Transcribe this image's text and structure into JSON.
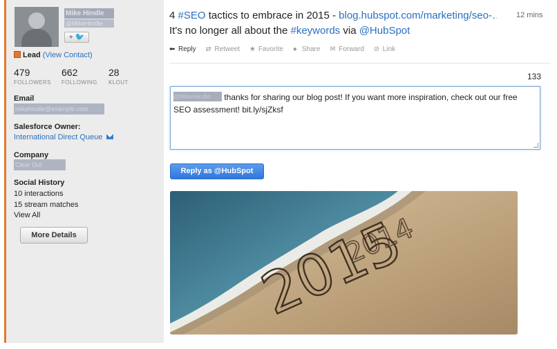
{
  "contact": {
    "name": "Mike Hindle",
    "handle": "@MikeHindle",
    "follow_label": "+",
    "lead_label": "Lead",
    "view_contact": "(View Contact)",
    "stats": [
      {
        "value": "479",
        "label": "FOLLOWERS"
      },
      {
        "value": "662",
        "label": "FOLLOWING"
      },
      {
        "value": "28",
        "label": "KLOUT"
      }
    ],
    "email_heading": "Email",
    "email_value": "mikehindle@example.com",
    "owner_heading": "Salesforce Owner:",
    "owner_value": "International Direct Queue",
    "company_heading": "Company",
    "company_value": "Clear Out",
    "social_heading": "Social History",
    "interactions": "10 interactions",
    "stream_matches": "15 stream matches",
    "view_all": "View All",
    "more_details": "More Details"
  },
  "tweet": {
    "line1_prefix": "4 ",
    "hashtag_seo": "#SEO",
    "line1_mid": " tactics to embrace in 2015 - ",
    "url": "blog.hubspot.com/marketing/seo-…",
    "line2_prefix": "It's no longer all about the ",
    "hashtag_keywords": "#keywords",
    "line2_mid": " via ",
    "mention": "@HubSpot",
    "time": "12 mins"
  },
  "actions": {
    "reply": "Reply",
    "retweet": "Retweet",
    "favorite": "Favorite",
    "share": "Share",
    "forward": "Forward",
    "link": "Link"
  },
  "composer": {
    "char_count": "133",
    "mention_hidden": "@MikeHindle",
    "text": "thanks for sharing our blog post! If you want more inspiration, check out our free SEO assessment! bit.ly/sjZksf",
    "reply_button": "Reply as @HubSpot"
  },
  "photo": {
    "year_old": "2014",
    "year_new": "2015"
  }
}
